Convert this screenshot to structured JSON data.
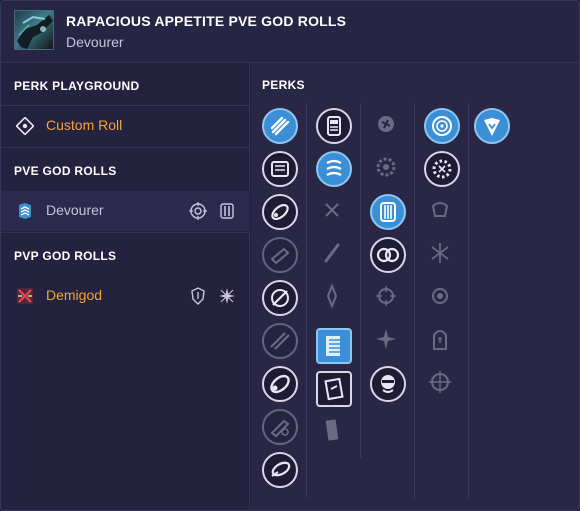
{
  "header": {
    "title": "RAPACIOUS APPETITE PVE GOD ROLLS",
    "subtitle": "Devourer"
  },
  "sidebar": {
    "perk_playground": {
      "title": "PERK PLAYGROUND",
      "custom_roll_label": "Custom Roll"
    },
    "pve": {
      "title": "PVE GOD ROLLS",
      "rolls": [
        {
          "label": "Devourer"
        }
      ]
    },
    "pvp": {
      "title": "PVP GOD ROLLS",
      "rolls": [
        {
          "label": "Demigod"
        }
      ]
    }
  },
  "perks": {
    "title": "PERKS",
    "columns": [
      [
        "selected",
        "normal",
        "normal",
        "faded",
        "normal",
        "faded",
        "normal",
        "faded",
        "normal"
      ],
      [
        "normal",
        "selected",
        "faded",
        "faded",
        "faded",
        "selected",
        "normal",
        "faded"
      ],
      [
        "faded",
        "faded",
        "selected",
        "normal",
        "faded",
        "faded",
        "normal"
      ],
      [
        "selected",
        "normal",
        "faded",
        "faded",
        "faded",
        "faded",
        "faded"
      ],
      [
        "selected"
      ]
    ]
  },
  "colors": {
    "accent_orange": "#f0a43a",
    "accent_blue": "#3b8fd6",
    "pvp_red": "#d8393c"
  }
}
